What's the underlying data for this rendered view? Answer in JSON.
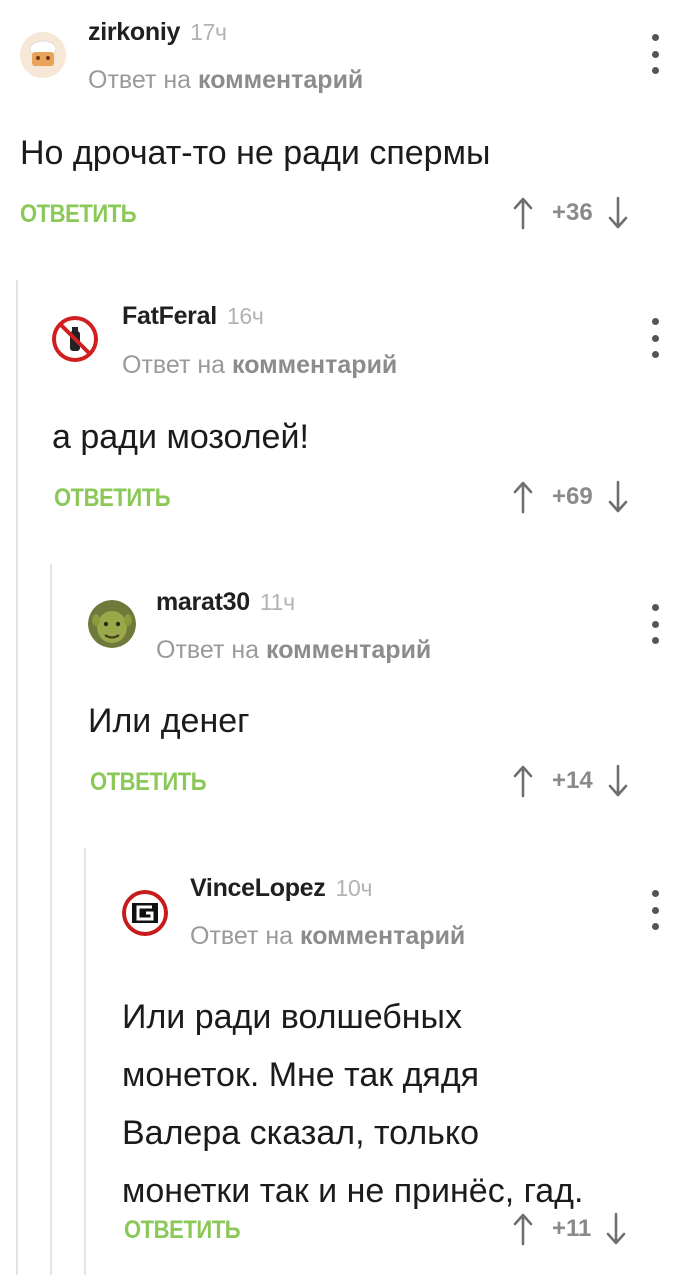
{
  "comments": [
    {
      "author": "zirkoniy",
      "time": "17ч",
      "reply_prefix": "Ответ на",
      "reply_target": "комментарий",
      "text": "Но дрочат-то не ради спермы",
      "reply_label": "ОТВЕТИТЬ",
      "score": "+36",
      "avatar_icon": "chef-avatar-icon"
    },
    {
      "author": "FatFeral",
      "time": "16ч",
      "reply_prefix": "Ответ на",
      "reply_target": "комментарий",
      "text": "а ради мозолей!",
      "reply_label": "ОТВЕТИТЬ",
      "score": "+69",
      "avatar_icon": "no-extinguisher-avatar-icon"
    },
    {
      "author": "marat30",
      "time": "11ч",
      "reply_prefix": "Ответ на",
      "reply_target": "комментарий",
      "text": "Или денег",
      "reply_label": "ОТВЕТИТЬ",
      "score": "+14",
      "avatar_icon": "ogre-face-avatar-icon"
    },
    {
      "author": "VinceLopez",
      "time": "10ч",
      "reply_prefix": "Ответ на",
      "reply_target": "комментарий",
      "text_lines": [
        "Или ради волшебных",
        "монеток. Мне так дядя",
        "Валера сказал, только",
        "монетки так и не принёс, гад."
      ],
      "reply_label": "ОТВЕТИТЬ",
      "score": "+11",
      "avatar_icon": "g-logo-avatar-icon"
    }
  ],
  "colors": {
    "reply_button": "#8ac858",
    "rail": "#e3e3e3",
    "meta": "#9a9a9a"
  }
}
